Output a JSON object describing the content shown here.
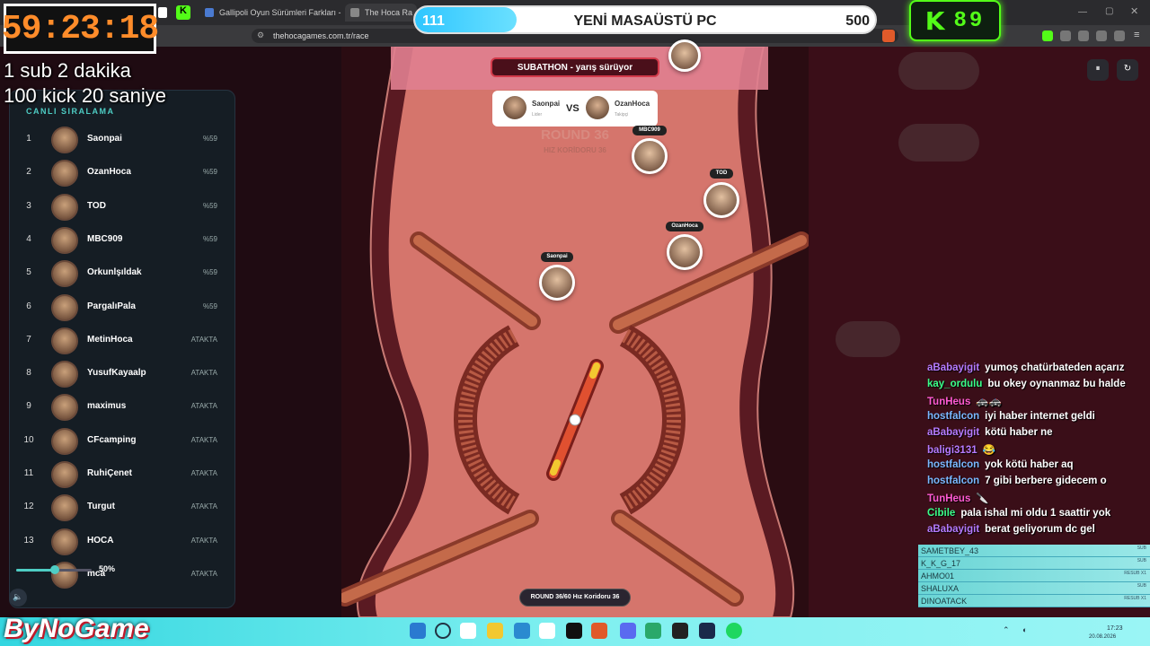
{
  "overlay": {
    "timer": "59:23:18",
    "line1": "1 sub 2 dakika",
    "line2": "100 kick 20 saniye"
  },
  "browser": {
    "tabs": [
      {
        "label": "Gallipoli Oyun Sürümleri Farkları - Gü"
      },
      {
        "label": "The Hoca Ra"
      }
    ],
    "url": "thehocagames.com.tr/race"
  },
  "goal": {
    "current": "111",
    "title": "YENİ MASAÜSTÜ PC",
    "target": "500",
    "fraction": 0.22
  },
  "kick": {
    "icon": "K",
    "count": "89"
  },
  "board": {
    "title": "CANLI SIRALAMA",
    "rows": [
      {
        "rank": "1",
        "name": "Saonpai",
        "status": "%59"
      },
      {
        "rank": "2",
        "name": "OzanHoca",
        "status": "%59"
      },
      {
        "rank": "3",
        "name": "TOD",
        "status": "%59"
      },
      {
        "rank": "4",
        "name": "MBC909",
        "status": "%59"
      },
      {
        "rank": "5",
        "name": "Orkunlşıldak",
        "status": "%59"
      },
      {
        "rank": "6",
        "name": "PargalıPala",
        "status": "%59"
      },
      {
        "rank": "7",
        "name": "MetinHoca",
        "status": "ATAKTA"
      },
      {
        "rank": "8",
        "name": "YusufKayaalp",
        "status": "ATAKTA"
      },
      {
        "rank": "9",
        "name": "maximus",
        "status": "ATAKTA"
      },
      {
        "rank": "10",
        "name": "CFcamping",
        "status": "ATAKTA"
      },
      {
        "rank": "11",
        "name": "RuhiÇenet",
        "status": "ATAKTA"
      },
      {
        "rank": "12",
        "name": "Turgut",
        "status": "ATAKTA"
      },
      {
        "rank": "13",
        "name": "HOCA",
        "status": "ATAKTA"
      },
      {
        "rank": "",
        "name": "mca",
        "status": "ATAKTA"
      }
    ],
    "volume": {
      "label": "50%",
      "fraction": 0.5
    }
  },
  "race": {
    "subathon": "SUBATHON - yarış sürüyor",
    "vs": {
      "left_name": "Saonpai",
      "left_role": "Lider",
      "vs": "VS",
      "right_name": "OzanHoca",
      "right_role": "Takipçi"
    },
    "round": "ROUND 36",
    "round_sub": "HIZ KORİDORU 36",
    "pill": "ROUND 36/60  Hız Koridoru 36",
    "players": {
      "mbc": "MBC909",
      "tod": "TOD",
      "ozan": "OzanHoca",
      "saonpai": "Saonpai"
    },
    "pause": "⏸",
    "restart": "↻"
  },
  "chat": [
    {
      "user": "aBabayigit",
      "color": "#b57bff",
      "msg": "yumoş chatürbateden açarız"
    },
    {
      "user": "kay_ordulu",
      "color": "#3aff8a",
      "msg": "bu okey oynanmaz bu halde"
    },
    {
      "user": "TunHeus",
      "color": "#ff5ad2",
      "msg": "🚓🚓"
    },
    {
      "user": "hostfalcon",
      "color": "#7ab8ff",
      "msg": "iyi haber internet geldi"
    },
    {
      "user": "aBabayigit",
      "color": "#b57bff",
      "msg": "kötü haber ne"
    },
    {
      "user": "baligi3131",
      "color": "#b57bff",
      "msg": "😂"
    },
    {
      "user": "hostfalcon",
      "color": "#7ab8ff",
      "msg": "yok kötü haber aq"
    },
    {
      "user": "hostfalcon",
      "color": "#7ab8ff",
      "msg": "7 gibi berbere gidecem o"
    },
    {
      "user": "TunHeus",
      "color": "#ff5ad2",
      "msg": "🔪"
    },
    {
      "user": "Cibile",
      "color": "#3aff8a",
      "msg": "pala ishal mi oldu 1 saattir yok"
    },
    {
      "user": "aBabayigit",
      "color": "#b57bff",
      "msg": "berat geliyorum dc gel"
    }
  ],
  "subs": [
    {
      "name": "SAMETBEY_43",
      "tag": "SUB"
    },
    {
      "name": "K_K_G_17",
      "tag": "SUB"
    },
    {
      "name": "AHMO01",
      "tag": "RESUB X1"
    },
    {
      "name": "SHALUXA",
      "tag": "SUB"
    },
    {
      "name": "DINOATACK",
      "tag": "RESUB X1"
    }
  ],
  "taskbar": {
    "logo": "ByNoGame",
    "time": "17:23",
    "date": "20.08.2026"
  }
}
